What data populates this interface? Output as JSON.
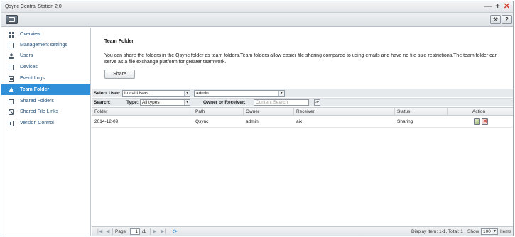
{
  "window": {
    "title": "Qsync Central Station 2.0"
  },
  "window_controls": {
    "minimize": "—",
    "maximize": "+",
    "close": "✕"
  },
  "toolbar": {
    "tools_icon": "⚒",
    "help_label": "?"
  },
  "sidebar": {
    "items": [
      {
        "label": "Overview",
        "icon": "overview-icon"
      },
      {
        "label": "Management settings",
        "icon": "management-icon"
      },
      {
        "label": "Users",
        "icon": "user-icon"
      },
      {
        "label": "Devices",
        "icon": "device-icon"
      },
      {
        "label": "Event Logs",
        "icon": "event-log-icon"
      },
      {
        "label": "Team Folder",
        "icon": "team-folder-icon",
        "active": true
      },
      {
        "label": "Shared Folders",
        "icon": "shared-folder-icon"
      },
      {
        "label": "Shared File Links",
        "icon": "link-icon"
      },
      {
        "label": "Version Control",
        "icon": "version-icon"
      }
    ]
  },
  "main": {
    "title": "Team Folder",
    "description": "You can share the folders in the Qsync folder as team folders.Team folders allow easier file sharing compared to using emails and have no file size restrictions.The team folder can serve as a file exchange platform for greater teamwork.",
    "share_label": "Share"
  },
  "filters": {
    "select_user_label": "Select User:",
    "user_type_value": "Local Users",
    "user_value": "admin",
    "search_label": "Search:",
    "type_label": "Type:",
    "type_value": "All types",
    "owner_receiver_label": "Owner or Receiver:",
    "content_search_placeholder": "Content Search"
  },
  "table": {
    "columns": [
      "Folder",
      "Path",
      "Owner",
      "Receiver",
      "Status",
      "Action"
    ],
    "rows": [
      {
        "folder": "2014-12-09",
        "path": "Qsync",
        "owner": "admin",
        "receiver": "aix",
        "status": "Sharing"
      }
    ]
  },
  "pager": {
    "page_label": "Page",
    "page_value": "1",
    "total_pages": "/1",
    "display_text": "Display item: 1-1, Total: 1",
    "show_label": "Show",
    "show_value": "100",
    "items_label": "Items"
  },
  "colors": {
    "accent": "#2f8fd8",
    "sidebar_text": "#1f4e79"
  }
}
